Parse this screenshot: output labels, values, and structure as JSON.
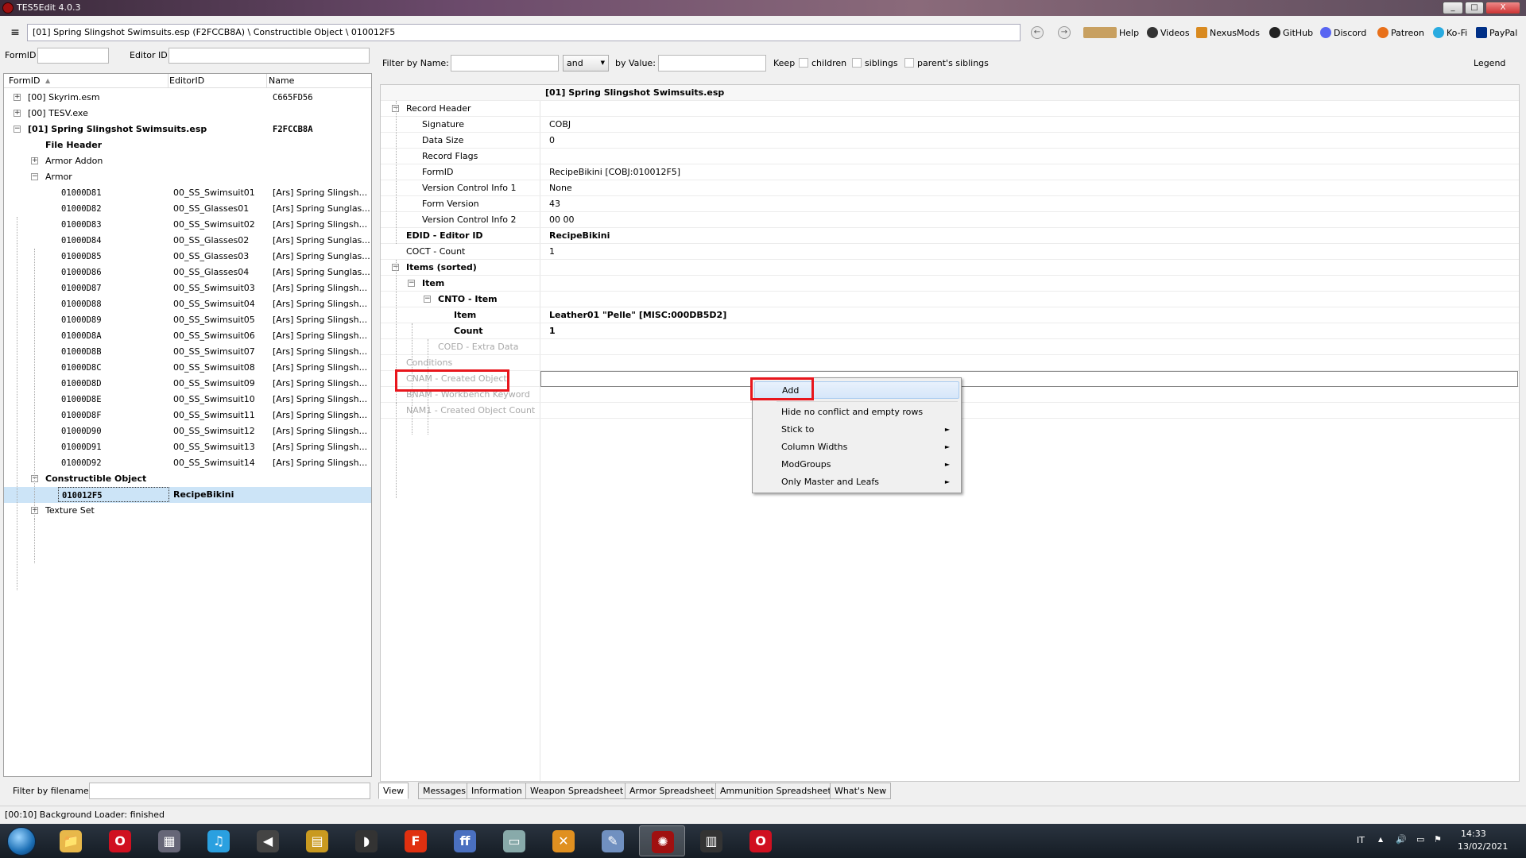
{
  "window": {
    "title": "TES5Edit 4.0.3",
    "min": "_",
    "max": "□",
    "close": "X"
  },
  "toolbar": {
    "menu_glyph": "≡",
    "path": "[01] Spring Slingshot Swimsuits.esp (F2FCCB8A) \\ Constructible Object \\ 010012F5",
    "back": "←",
    "forward": "→",
    "links": [
      "Help",
      "Videos",
      "NexusMods",
      "GitHub",
      "Discord",
      "Patreon",
      "Ko-Fi",
      "PayPal"
    ]
  },
  "left": {
    "formid_label": "FormID",
    "editorid_label": "Editor ID",
    "columns": {
      "formid": "FormID",
      "editorid": "EditorID",
      "name": "Name",
      "sort_glyph": "▲"
    },
    "filter_by_filename": "Filter by filename:",
    "tree": [
      {
        "fid": "[00] Skyrim.esm",
        "eid": "",
        "name": "C665FD56"
      },
      {
        "fid": "[00] TESV.exe",
        "eid": "",
        "name": ""
      },
      {
        "fid": "[01] Spring Slingshot Swimsuits.esp",
        "eid": "",
        "name": "F2FCCB8A"
      },
      {
        "fid": "File Header",
        "eid": "",
        "name": ""
      },
      {
        "fid": "Armor Addon",
        "eid": "",
        "name": ""
      },
      {
        "fid": "Armor",
        "eid": "",
        "name": ""
      },
      {
        "fid": "01000D81",
        "eid": "00_SS_Swimsuit01",
        "name": "[Ars] Spring Slingsh..."
      },
      {
        "fid": "01000D82",
        "eid": "00_SS_Glasses01",
        "name": "[Ars] Spring Sunglas..."
      },
      {
        "fid": "01000D83",
        "eid": "00_SS_Swimsuit02",
        "name": "[Ars] Spring Slingsh..."
      },
      {
        "fid": "01000D84",
        "eid": "00_SS_Glasses02",
        "name": "[Ars] Spring Sunglas..."
      },
      {
        "fid": "01000D85",
        "eid": "00_SS_Glasses03",
        "name": "[Ars] Spring Sunglas..."
      },
      {
        "fid": "01000D86",
        "eid": "00_SS_Glasses04",
        "name": "[Ars] Spring Sunglas..."
      },
      {
        "fid": "01000D87",
        "eid": "00_SS_Swimsuit03",
        "name": "[Ars] Spring Slingsh..."
      },
      {
        "fid": "01000D88",
        "eid": "00_SS_Swimsuit04",
        "name": "[Ars] Spring Slingsh..."
      },
      {
        "fid": "01000D89",
        "eid": "00_SS_Swimsuit05",
        "name": "[Ars] Spring Slingsh..."
      },
      {
        "fid": "01000D8A",
        "eid": "00_SS_Swimsuit06",
        "name": "[Ars] Spring Slingsh..."
      },
      {
        "fid": "01000D8B",
        "eid": "00_SS_Swimsuit07",
        "name": "[Ars] Spring Slingsh..."
      },
      {
        "fid": "01000D8C",
        "eid": "00_SS_Swimsuit08",
        "name": "[Ars] Spring Slingsh..."
      },
      {
        "fid": "01000D8D",
        "eid": "00_SS_Swimsuit09",
        "name": "[Ars] Spring Slingsh..."
      },
      {
        "fid": "01000D8E",
        "eid": "00_SS_Swimsuit10",
        "name": "[Ars] Spring Slingsh..."
      },
      {
        "fid": "01000D8F",
        "eid": "00_SS_Swimsuit11",
        "name": "[Ars] Spring Slingsh..."
      },
      {
        "fid": "01000D90",
        "eid": "00_SS_Swimsuit12",
        "name": "[Ars] Spring Slingsh..."
      },
      {
        "fid": "01000D91",
        "eid": "00_SS_Swimsuit13",
        "name": "[Ars] Spring Slingsh..."
      },
      {
        "fid": "01000D92",
        "eid": "00_SS_Swimsuit14",
        "name": "[Ars] Spring Slingsh..."
      },
      {
        "fid": "Constructible Object",
        "eid": "",
        "name": ""
      },
      {
        "fid": "010012F5",
        "eid": "RecipeBikini",
        "name": ""
      },
      {
        "fid": "Texture Set",
        "eid": "",
        "name": ""
      }
    ]
  },
  "filter": {
    "by_name": "Filter by Name:",
    "and": "and",
    "dropdown_arrow": "▼",
    "by_value": "by Value:",
    "keep": "Keep",
    "children": "children",
    "siblings": "siblings",
    "parents_siblings": "parent's siblings",
    "legend": "Legend"
  },
  "record": {
    "file_header": "[01] Spring Slingshot Swimsuits.esp",
    "rows": [
      {
        "label": "Record Header",
        "value": ""
      },
      {
        "label": "Signature",
        "value": "COBJ"
      },
      {
        "label": "Data Size",
        "value": "0"
      },
      {
        "label": "Record Flags",
        "value": ""
      },
      {
        "label": "FormID",
        "value": "RecipeBikini [COBJ:010012F5]"
      },
      {
        "label": "Version Control Info 1",
        "value": "None"
      },
      {
        "label": "Form Version",
        "value": "43"
      },
      {
        "label": "Version Control Info 2",
        "value": "00 00"
      },
      {
        "label": "EDID - Editor ID",
        "value": "RecipeBikini"
      },
      {
        "label": "COCT - Count",
        "value": "1"
      },
      {
        "label": "Items (sorted)",
        "value": ""
      },
      {
        "label": "Item",
        "value": ""
      },
      {
        "label": "CNTO - Item",
        "value": ""
      },
      {
        "label": "Item",
        "value": "Leather01 \"Pelle\" [MISC:000DB5D2]"
      },
      {
        "label": "Count",
        "value": "1"
      },
      {
        "label": "COED - Extra Data",
        "value": ""
      },
      {
        "label": "Conditions",
        "value": ""
      },
      {
        "label": "CNAM - Created Object",
        "value": ""
      },
      {
        "label": "BNAM - Workbench Keyword",
        "value": ""
      },
      {
        "label": "NAM1 - Created Object Count",
        "value": ""
      }
    ]
  },
  "tabs": [
    "View",
    "Messages",
    "Information",
    "Weapon Spreadsheet",
    "Armor Spreadsheet",
    "Ammunition Spreadsheet",
    "What's New"
  ],
  "context_menu": {
    "items": [
      {
        "label": "Add",
        "submenu": false
      },
      {
        "label": "Hide no conflict and empty rows",
        "submenu": false
      },
      {
        "label": "Stick to",
        "submenu": true
      },
      {
        "label": "Column Widths",
        "submenu": true
      },
      {
        "label": "ModGroups",
        "submenu": true
      },
      {
        "label": "Only Master and Leafs",
        "submenu": true
      }
    ],
    "submenu_arrow": "►"
  },
  "status": "[00:10] Background Loader: finished",
  "taskbar": {
    "tray_lang": "IT",
    "time": "14:33",
    "date": "13/02/2021",
    "tray_up_arrow": "▲",
    "volume_glyph": "🔊",
    "flag_glyph": "⚑",
    "apps": [
      {
        "id": "explorer",
        "glyph": "📁",
        "color": "#e8b84a"
      },
      {
        "id": "opera",
        "glyph": "O",
        "color": "#d01020"
      },
      {
        "id": "media",
        "glyph": "▦",
        "color": "#667"
      },
      {
        "id": "itunes",
        "glyph": "♫",
        "color": "#2aa0e0"
      },
      {
        "id": "speaker",
        "glyph": "◀",
        "color": "#444"
      },
      {
        "id": "notepad",
        "glyph": "▤",
        "color": "#c99a20"
      },
      {
        "id": "shield",
        "glyph": "◗",
        "color": "#333"
      },
      {
        "id": "foxit",
        "glyph": "F",
        "color": "#e03010"
      },
      {
        "id": "ffdec",
        "glyph": "ff",
        "color": "#4a70c0"
      },
      {
        "id": "window",
        "glyph": "▭",
        "color": "#8aa"
      },
      {
        "id": "game",
        "glyph": "✕",
        "color": "#e09020"
      },
      {
        "id": "quill",
        "glyph": "✎",
        "color": "#7090c0"
      },
      {
        "id": "tes5edit",
        "glyph": "✺",
        "color": "#a01010"
      },
      {
        "id": "people",
        "glyph": "▥",
        "color": "#333"
      },
      {
        "id": "opera2",
        "glyph": "O",
        "color": "#d01020"
      }
    ]
  },
  "colors": {
    "highlight": "#e8161d",
    "selection": "#cce4f7",
    "accent": "#0066cc"
  }
}
